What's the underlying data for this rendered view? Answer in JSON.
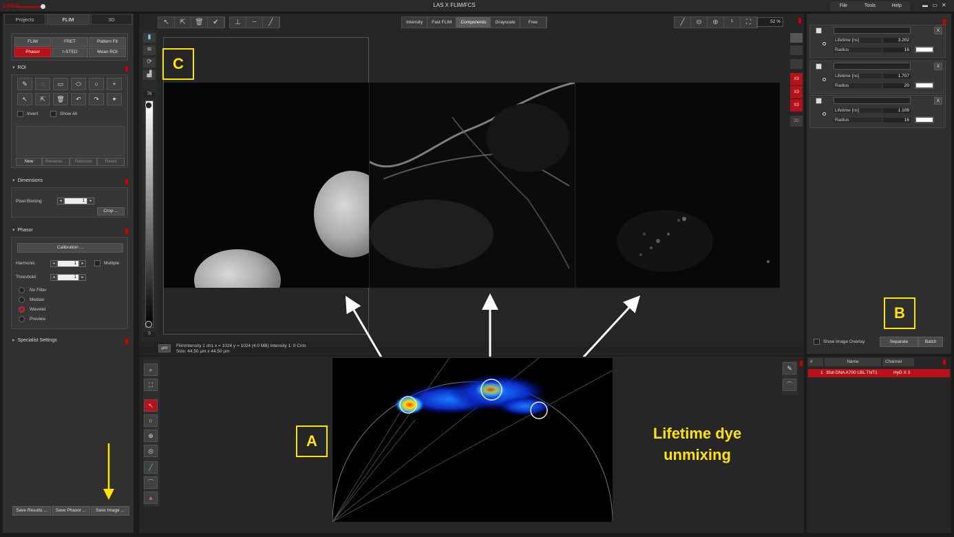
{
  "app": {
    "title": "LAS X FLIM/FCS",
    "logo_text": "Leica"
  },
  "menu": [
    "File",
    "Tools",
    "Help"
  ],
  "left": {
    "tabs": [
      "Projects",
      "FLIM",
      "3D"
    ],
    "modes_row1": [
      "FLIM",
      "FRET",
      "Pattern Fit"
    ],
    "modes_row2": [
      "Phasor",
      "τ-STED",
      "Mean ROI"
    ],
    "roi": {
      "title": "ROI",
      "invert": "Invert",
      "show_all": "Show All",
      "buttons": [
        "New",
        "Rename...",
        "Remove",
        "Reset"
      ]
    },
    "dimensions": {
      "title": "Dimensions",
      "pixel_binning_label": "Pixel Binning",
      "pixel_binning_value": "1",
      "crop": "Crop ..."
    },
    "phasor": {
      "title": "Phasor",
      "calibration": "Calibration ...",
      "harmonic_label": "Harmonic",
      "harmonic_value": "1",
      "multiple": "Multiple",
      "threshold_label": "Threshold",
      "threshold_value": "1",
      "filters": [
        "No Filter",
        "Median",
        "Wavelet",
        "Preview"
      ]
    },
    "specialist": "Specialist Settings",
    "save_buttons": [
      "Save Results ...",
      "Save Phasor ...",
      "Save Image ..."
    ]
  },
  "view": {
    "tabs": [
      "Intensity",
      "Fast FLIM",
      "Components",
      "Grayscale",
      "Free"
    ],
    "zoom": "52 %",
    "slider_top": "76",
    "slider_bottom": "0",
    "right_icons": [
      "X3",
      "X3",
      "X3",
      "3D"
    ],
    "unit_button": "µm",
    "status_line1": "FlimIntensity 1 ch1   x = 1024 y = 1024  (4.0 MB)  Intensity 1: 0 Cnts",
    "status_line2": "Size: 44.50 µm x 44.50 µm"
  },
  "components": [
    {
      "lifetime_label": "Lifetime [ns]",
      "lifetime": "3.202",
      "radius_label": "Radius",
      "radius": "16"
    },
    {
      "lifetime_label": "Lifetime [ns]",
      "lifetime": "1.707",
      "radius_label": "Radius",
      "radius": "20"
    },
    {
      "lifetime_label": "Lifetime [ns]",
      "lifetime": "1.109",
      "radius_label": "Radius",
      "radius": "16"
    }
  ],
  "right_bottom": {
    "show_overlay": "Show Image Overlay",
    "separate": "Separate",
    "batch": "Batch"
  },
  "table": {
    "headers": [
      "#",
      "Name",
      "Channel"
    ],
    "rows": [
      {
        "num": "1",
        "name": "3full DNA A700 LBL TNT1",
        "channel": "HyD X 3"
      }
    ]
  },
  "annotations": {
    "a": "A",
    "b": "B",
    "c": "C",
    "caption_line1": "Lifetime dye",
    "caption_line2": "unmixing"
  },
  "colors": {
    "accent_red": "#b5121b",
    "annotation_yellow": "#ffe400"
  }
}
